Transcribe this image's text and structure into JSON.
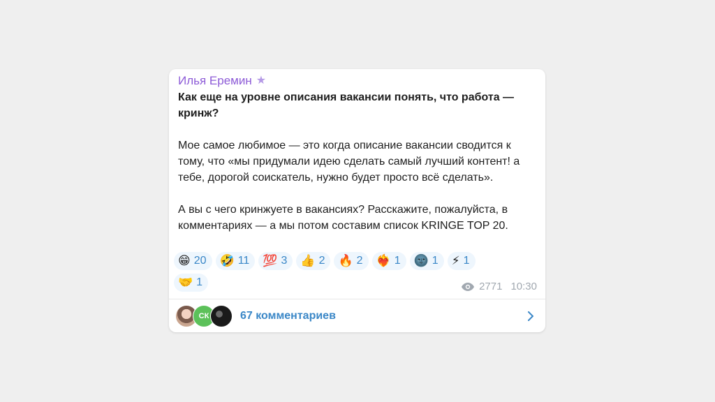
{
  "post": {
    "author": "Илья Еремин",
    "title": "Как еще на уровне описания вакансии понять, что работа — кринж?",
    "paragraph1": "Мое самое любимое — это когда описание вакансии сводится к тому, что «мы придумали идею сделать самый лучший контент! а тебе, дорогой соискатель, нужно будет просто всё сделать».",
    "paragraph2": "А вы с чего кринжуете в вакансиях? Расскажите, пожалуйста, в комментариях — а мы потом составим список KRINGE TOP 20."
  },
  "reactions": [
    {
      "emoji": "😁",
      "count": "20"
    },
    {
      "emoji": "🤣",
      "count": "11"
    },
    {
      "emoji": "💯",
      "count": "3"
    },
    {
      "emoji": "👍",
      "count": "2"
    },
    {
      "emoji": "🔥",
      "count": "2"
    },
    {
      "emoji": "❤️‍🔥",
      "count": "1"
    },
    {
      "emoji": "🌚",
      "count": "1"
    },
    {
      "emoji": "⚡",
      "count": "1"
    },
    {
      "emoji": "🤝",
      "count": "1"
    }
  ],
  "meta": {
    "views": "2771",
    "time": "10:30"
  },
  "footer": {
    "avatar2_initials": "СК",
    "comments_label": "67 комментариев"
  },
  "colors": {
    "author": "#8d5bd7",
    "link": "#3a87c7",
    "reaction_bg": "#eef6fd"
  }
}
